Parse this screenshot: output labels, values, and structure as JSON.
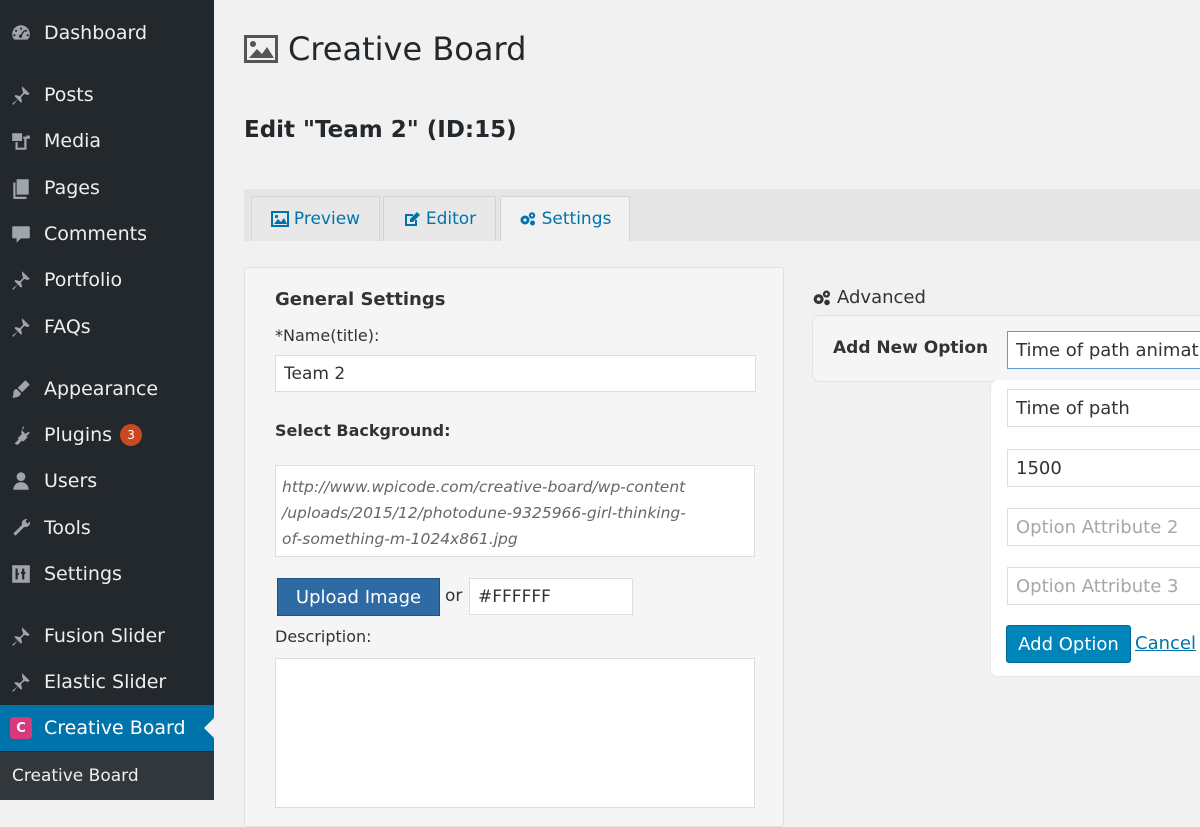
{
  "sidebar": {
    "items": [
      {
        "label": "Dashboard",
        "icon": "dashboard-icon"
      },
      {
        "label": "Posts",
        "icon": "pin-icon"
      },
      {
        "label": "Media",
        "icon": "media-icon"
      },
      {
        "label": "Pages",
        "icon": "pages-icon"
      },
      {
        "label": "Comments",
        "icon": "comment-icon"
      },
      {
        "label": "Portfolio",
        "icon": "pin-icon"
      },
      {
        "label": "FAQs",
        "icon": "pin-icon"
      },
      {
        "label": "Appearance",
        "icon": "brush-icon"
      },
      {
        "label": "Plugins",
        "icon": "plugin-icon",
        "badge": "3"
      },
      {
        "label": "Users",
        "icon": "user-icon"
      },
      {
        "label": "Tools",
        "icon": "wrench-icon"
      },
      {
        "label": "Settings",
        "icon": "settings-sliders-icon"
      },
      {
        "label": "Fusion Slider",
        "icon": "pin-icon"
      },
      {
        "label": "Elastic Slider",
        "icon": "pin-icon"
      },
      {
        "label": "Creative Board",
        "icon": "creative-board-logo-icon",
        "logo_letter": "C"
      }
    ],
    "submenu_label": "Creative Board",
    "active_color": "#0073aa",
    "bg_color": "#23282d"
  },
  "header": {
    "title": "Creative Board",
    "edit_title": "Edit \"Team 2\" (ID:15)"
  },
  "tabs": [
    {
      "label": "Preview",
      "icon": "image-icon"
    },
    {
      "label": "Editor",
      "icon": "edit-icon"
    },
    {
      "label": "Settings",
      "icon": "gears-icon",
      "active": true
    }
  ],
  "general": {
    "heading": "General Settings",
    "name_label": "*Name(title):",
    "name_value": "Team 2",
    "background_label": "Select Background:",
    "background_url": "http://www.wpicode.com/creative-board/wp-content\n/uploads/2015/12/photodune-9325966-girl-thinking-\nof-something-m-1024x861.jpg",
    "upload_label": "Upload Image",
    "or_text": "or",
    "color_value": "#FFFFFF",
    "description_label": "Description:",
    "description_value": ""
  },
  "advanced": {
    "heading": "Advanced",
    "add_new_label": "Add New Option",
    "option_select_value": "Time of path animat",
    "field1_value": "Time of path",
    "field2_value": "1500",
    "attr2_placeholder": "Option Attribute 2",
    "attr3_placeholder": "Option Attribute 3",
    "add_button": "Add Option",
    "cancel_link": "Cancel"
  }
}
